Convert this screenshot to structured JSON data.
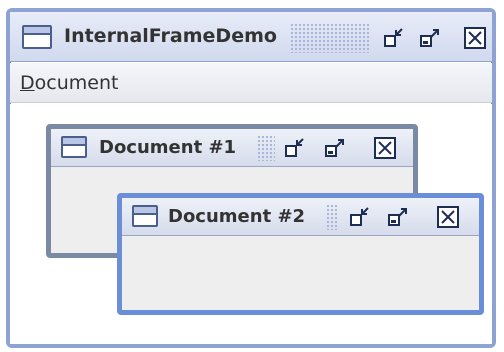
{
  "main_window": {
    "title": "InternalFrameDemo",
    "menu": {
      "document_label": "Document",
      "mnemonic": "D",
      "rest": "ocument"
    }
  },
  "internal_frames": [
    {
      "title": "Document #1"
    },
    {
      "title": "Document #2"
    }
  ],
  "colors": {
    "main_border": "#8ea3d4",
    "inactive_frame_border": "#7b8aa3",
    "active_frame_border": "#6a8ed8",
    "title_text": "#333333"
  },
  "icons": [
    "window-icon",
    "iconify-icon",
    "maximize-icon",
    "close-icon"
  ]
}
